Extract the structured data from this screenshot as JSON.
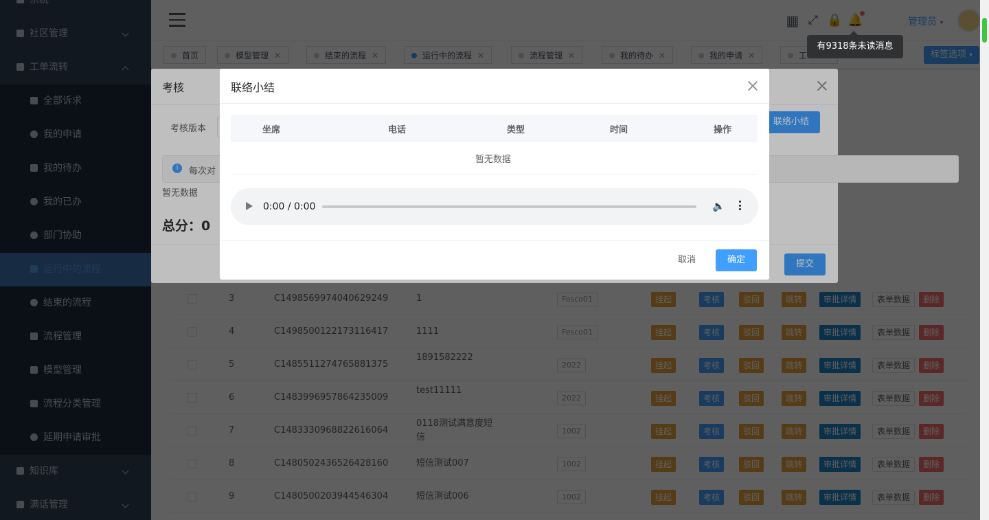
{
  "sidebar": {
    "items": [
      {
        "label": "系统",
        "type": "top"
      },
      {
        "label": "社区管理",
        "type": "top"
      },
      {
        "label": "工单流转",
        "type": "top"
      },
      {
        "label": "全部诉求",
        "type": "sub"
      },
      {
        "label": "我的申请",
        "type": "sub"
      },
      {
        "label": "我的待办",
        "type": "sub"
      },
      {
        "label": "我的已办",
        "type": "sub"
      },
      {
        "label": "部门协助",
        "type": "sub"
      },
      {
        "label": "运行中的流程",
        "type": "sub"
      },
      {
        "label": "结束的流程",
        "type": "sub"
      },
      {
        "label": "流程管理",
        "type": "sub"
      },
      {
        "label": "模型管理",
        "type": "sub"
      },
      {
        "label": "流程分类管理",
        "type": "sub"
      },
      {
        "label": "延期申请审批",
        "type": "sub"
      },
      {
        "label": "知识库",
        "type": "top"
      },
      {
        "label": "满话管理",
        "type": "top"
      }
    ]
  },
  "navbar": {
    "user": "管理员",
    "tooltip": "有9318条未读消息"
  },
  "tags": {
    "items": [
      "首页",
      "模型管理",
      "结束的流程",
      "运行中的流程",
      "流程管理",
      "我的待办",
      "我的申请",
      "工"
    ],
    "options_label": "标签选项"
  },
  "table": {
    "rows": [
      {
        "idx": "3",
        "code": "C1498569974040629249",
        "title": "1",
        "badge": "Fesco01"
      },
      {
        "idx": "4",
        "code": "C1498500122173116417",
        "title": "1111",
        "badge": "Fesco01"
      },
      {
        "idx": "5",
        "code": "C1485511274765881375",
        "title": "1891582222",
        "badge": "2022"
      },
      {
        "idx": "6",
        "code": "C1483996957864235009",
        "title": "test11111",
        "badge": "2022"
      },
      {
        "idx": "7",
        "code": "C1483330968822616064",
        "title": "0118测试满意度短信",
        "badge": "1002"
      },
      {
        "idx": "8",
        "code": "C1480502436526428160",
        "title": "短信测试007",
        "badge": "1002"
      },
      {
        "idx": "9",
        "code": "C1480500203944546304",
        "title": "短信测试006",
        "badge": "1002"
      }
    ],
    "actions": [
      "挂起",
      "考核",
      "驳回",
      "跳转",
      "审批详情",
      "表单数据",
      "删除"
    ]
  },
  "dialog1": {
    "title": "考核",
    "version_label": "考核版本",
    "info": "每次对",
    "empty": "暂无数据",
    "score": "总分：0",
    "contact_button": "联络小结",
    "submit": "提交"
  },
  "dialog2": {
    "title": "联络小结",
    "columns": [
      "坐席",
      "电话",
      "类型",
      "时间",
      "操作"
    ],
    "empty": "暂无数据",
    "audio_time": "0:00 / 0:00",
    "cancel": "取消",
    "confirm": "确定"
  }
}
